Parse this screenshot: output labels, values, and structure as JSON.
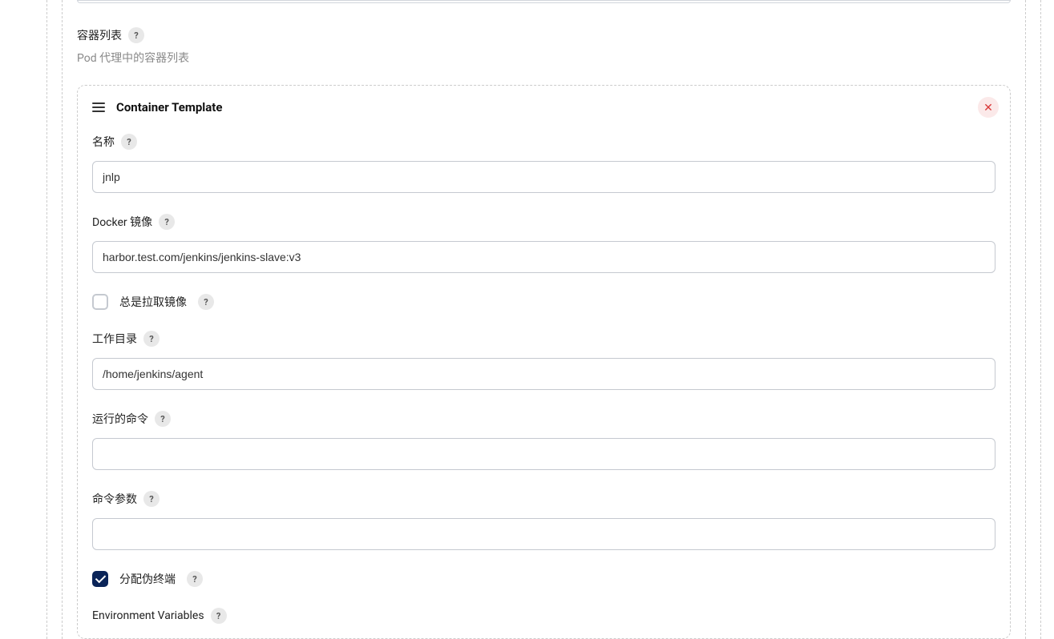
{
  "section": {
    "list_label": "容器列表",
    "list_description": "Pod 代理中的容器列表"
  },
  "template": {
    "title": "Container Template",
    "fields": {
      "name": {
        "label": "名称",
        "value": "jnlp"
      },
      "docker_image": {
        "label": "Docker 镜像",
        "value": "harbor.test.com/jenkins/jenkins-slave:v3"
      },
      "always_pull": {
        "label": "总是拉取镜像",
        "checked": false
      },
      "working_dir": {
        "label": "工作目录",
        "value": "/home/jenkins/agent"
      },
      "command": {
        "label": "运行的命令",
        "value": ""
      },
      "args": {
        "label": "命令参数",
        "value": ""
      },
      "tty": {
        "label": "分配伪终端",
        "checked": true
      },
      "env_vars": {
        "label": "Environment Variables"
      }
    }
  },
  "help_icon": "?"
}
